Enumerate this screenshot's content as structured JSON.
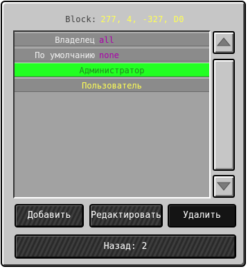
{
  "header": {
    "label": "Block:",
    "coords": "277, 4, -327, D0"
  },
  "permissions": [
    {
      "key": "Владелец",
      "value": "all"
    },
    {
      "key": "По умолчанию",
      "value": "none"
    }
  ],
  "groups": [
    {
      "name": "Администратор",
      "selected": true
    },
    {
      "name": "Пользователь",
      "selected": false
    }
  ],
  "buttons": {
    "add": "Добавить",
    "edit": "Редактировать",
    "delete": "Удалить",
    "back": "Назад: 2"
  },
  "colors": {
    "coords": "#ffff55",
    "perm_value": "#aa00aa",
    "selected_row": "#22ff22",
    "group_text": "#ffff55"
  }
}
